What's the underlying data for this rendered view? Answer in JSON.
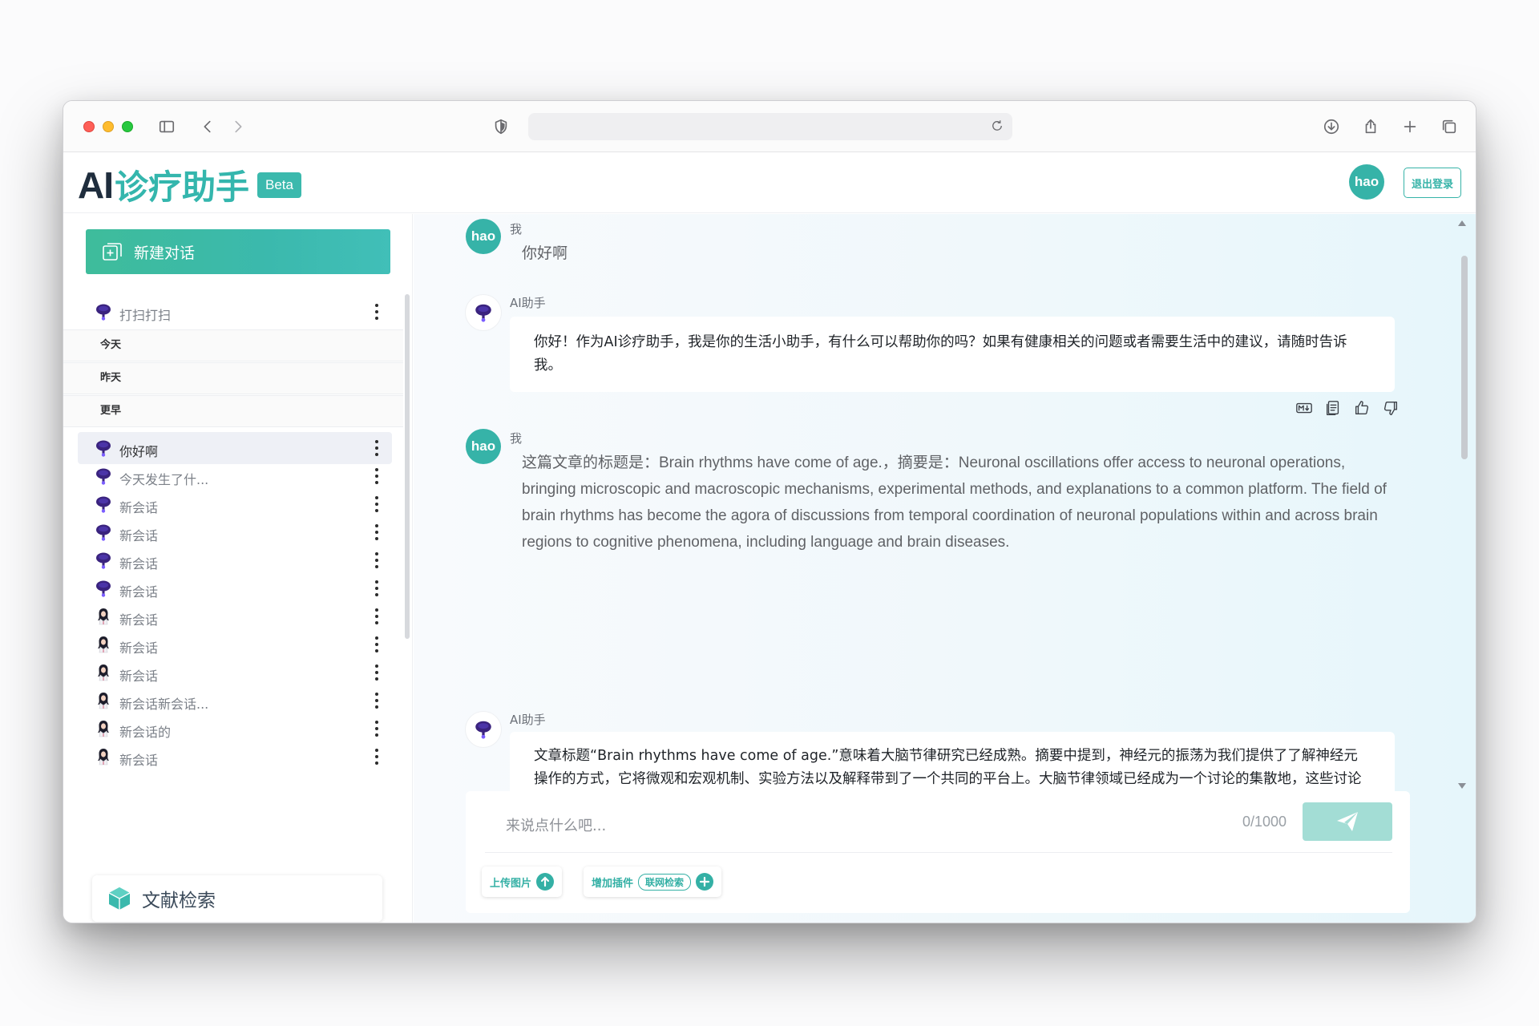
{
  "app": {
    "brand_ai": "AI",
    "brand_cn": "诊疗助手",
    "badge": "Beta",
    "user_avatar_text": "hao",
    "logout_label": "退出登录"
  },
  "sidebar": {
    "new_chat_label": "新建对话",
    "pinned": [
      {
        "label": "打扫打扫",
        "icon": "robot-avatar-icon"
      }
    ],
    "groups": {
      "today": "今天",
      "yesterday": "昨天",
      "earlier": "更早"
    },
    "items": [
      {
        "label": "你好啊",
        "icon": "robot-avatar-icon",
        "active": true
      },
      {
        "label": "今天发生了什...",
        "icon": "robot-avatar-icon"
      },
      {
        "label": "新会话",
        "icon": "robot-avatar-icon"
      },
      {
        "label": "新会话",
        "icon": "robot-avatar-icon"
      },
      {
        "label": "新会话",
        "icon": "robot-avatar-icon"
      },
      {
        "label": "新会话",
        "icon": "robot-avatar-icon"
      },
      {
        "label": "新会话",
        "icon": "doctor-avatar-icon"
      },
      {
        "label": "新会话",
        "icon": "doctor-avatar-icon"
      },
      {
        "label": "新会话",
        "icon": "doctor-avatar-icon"
      },
      {
        "label": "新会话新会话...",
        "icon": "doctor-avatar-icon"
      },
      {
        "label": "新会话的",
        "icon": "doctor-avatar-icon"
      },
      {
        "label": "新会话",
        "icon": "doctor-avatar-icon"
      }
    ],
    "literature_search_label": "文献检索"
  },
  "chat": {
    "messages": [
      {
        "role": "user",
        "name": "我",
        "avatar": "hao",
        "text": "你好啊"
      },
      {
        "role": "ai",
        "name": "AI助手",
        "text": "你好！作为AI诊疗助手，我是你的生活小助手，有什么可以帮助你的吗？如果有健康相关的问题或者需要生活中的建议，请随时告诉我。"
      },
      {
        "role": "user",
        "name": "我",
        "avatar": "hao",
        "text": "这篇文章的标题是：Brain rhythms have come of age.，摘要是：Neuronal oscillations offer access to neuronal operations, bringing microscopic and macroscopic mechanisms, experimental methods, and explanations to a common platform. The field of brain rhythms has become the agora of discussions from temporal coordination of neuronal populations within and across brain regions to cognitive phenomena, including language and brain diseases."
      },
      {
        "role": "ai",
        "name": "AI助手",
        "text": "文章标题“Brain rhythms have come of age.”意味着大脑节律研究已经成熟。摘要中提到，神经元的振荡为我们提供了了解神经元操作的方式，它将微观和宏观机制、实验方法以及解释带到了一个共同的平台上。大脑节律领域已经成为一个讨论的集散地，这些讨论涵盖了从大脑内和跨区域神经群体的时间协调，到包括语言和大脑疾病在内的认知现象。这表明，对大脑节律的研究正在成为理解大脑功能和认知过程的关键途径，并且在神经科学领域的重要性日益增加。"
      }
    ],
    "message_actions": [
      "markdown-icon",
      "copy-icon",
      "thumbs-up-icon",
      "thumbs-down-icon"
    ]
  },
  "composer": {
    "placeholder": "来说点什么吧...",
    "counter": "0/1000",
    "upload_label": "上传图片",
    "plugin_label": "增加插件",
    "plugin_pill": "联网检索"
  },
  "colors": {
    "accent": "#36b3a8",
    "send_button": "#a3ddd5"
  }
}
